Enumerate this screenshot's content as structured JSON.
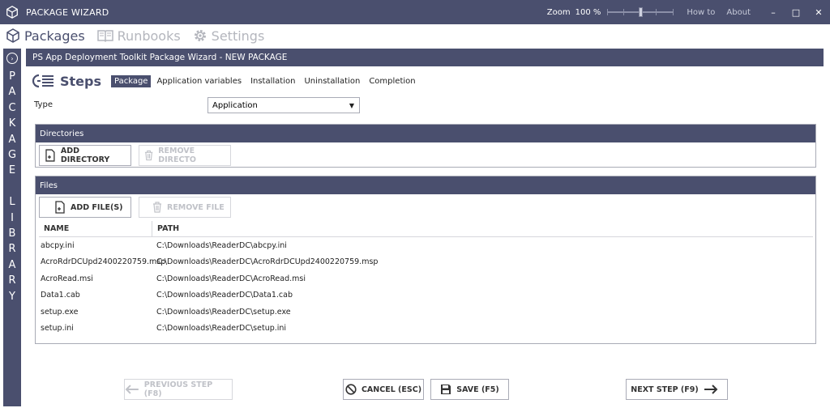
{
  "titlebar": {
    "title": "PACKAGE WIZARD",
    "zoom_label": "Zoom",
    "zoom_value": "100 %",
    "zoom_level": 0.5,
    "how_to": "How to",
    "about": "About",
    "minimize": "–",
    "maximize": "□",
    "close": "✕"
  },
  "menu": {
    "items": [
      {
        "label": "Packages",
        "icon": "cube-icon",
        "state": "active"
      },
      {
        "label": "Runbooks",
        "icon": "book-icon",
        "state": "disabled"
      },
      {
        "label": "Settings",
        "icon": "gear-icon",
        "state": "disabled"
      }
    ]
  },
  "library_strip": {
    "letters": [
      "P",
      "A",
      "C",
      "K",
      "A",
      "G",
      "E",
      " ",
      "L",
      "I",
      "B",
      "R",
      "A",
      "R",
      "Y"
    ]
  },
  "wizard": {
    "header": "PS App Deployment Toolkit Package Wizard  -  NEW PACKAGE",
    "steps_title": "Steps",
    "tabs": [
      "Package",
      "Application variables",
      "Installation",
      "Uninstallation",
      "Completion"
    ],
    "active_tab": "Package"
  },
  "type": {
    "label": "Type",
    "value": "Application"
  },
  "directories": {
    "header": "Directories",
    "add_label": "ADD DIRECTORY",
    "remove_label": "REMOVE DIRECTO"
  },
  "files": {
    "header": "Files",
    "add_label": "ADD FILE(S)",
    "remove_label": "REMOVE FILE",
    "columns": {
      "name": "NAME",
      "path": "PATH"
    },
    "rows": [
      {
        "name": "abcpy.ini",
        "path": "C:\\Downloads\\ReaderDC\\abcpy.ini"
      },
      {
        "name": "AcroRdrDCUpd2400220759.msp",
        "path": "C:\\Downloads\\ReaderDC\\AcroRdrDCUpd2400220759.msp"
      },
      {
        "name": "AcroRead.msi",
        "path": "C:\\Downloads\\ReaderDC\\AcroRead.msi"
      },
      {
        "name": "Data1.cab",
        "path": "C:\\Downloads\\ReaderDC\\Data1.cab"
      },
      {
        "name": "setup.exe",
        "path": "C:\\Downloads\\ReaderDC\\setup.exe"
      },
      {
        "name": "setup.ini",
        "path": "C:\\Downloads\\ReaderDC\\setup.ini"
      }
    ]
  },
  "footer": {
    "previous_label": "PREVIOUS STEP (F8)",
    "cancel_label": "CANCEL (ESC)",
    "save_label": "SAVE (F5)",
    "next_label": "NEXT STEP (F9)"
  },
  "colors": {
    "accent": "#4a4f6e",
    "disabled": "#b4b6bd"
  }
}
